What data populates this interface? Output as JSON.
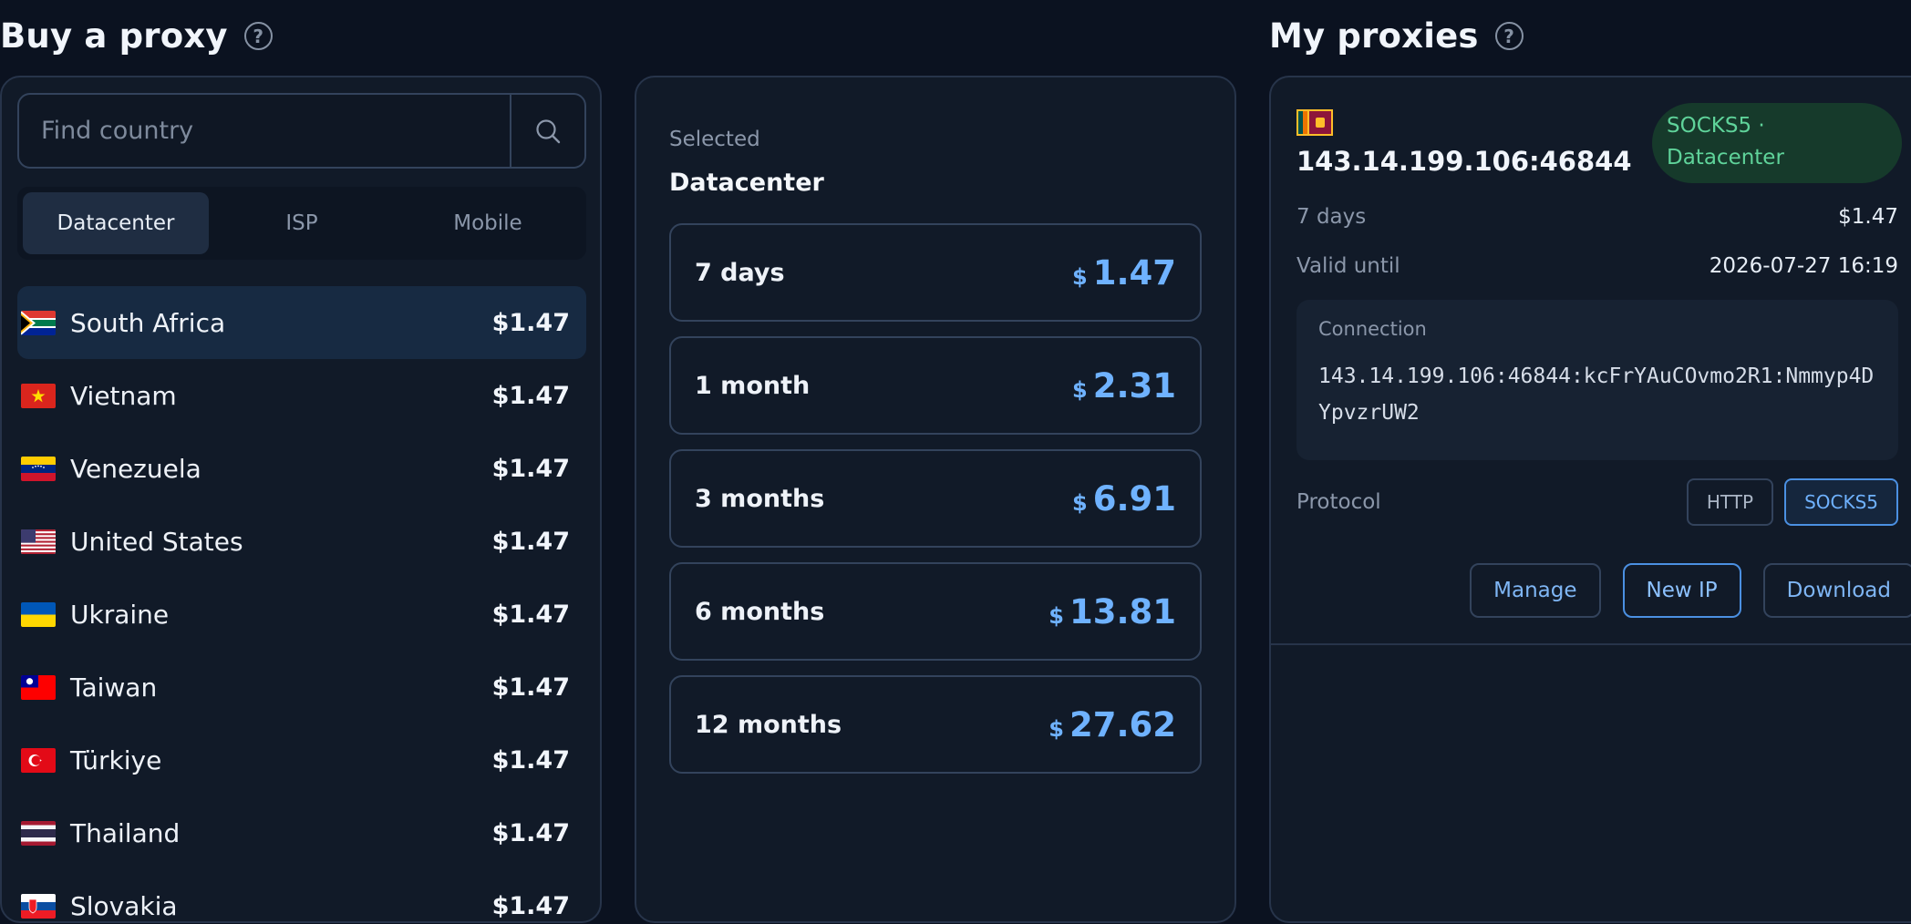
{
  "buy": {
    "title": "Buy a proxy",
    "help": "?",
    "search": {
      "placeholder": "Find country"
    },
    "tabs": [
      {
        "label": "Datacenter",
        "active": true
      },
      {
        "label": "ISP",
        "active": false
      },
      {
        "label": "Mobile",
        "active": false
      }
    ],
    "countries": [
      {
        "name": "South Africa",
        "price": "$1.47",
        "flag": "za-flag-icon",
        "selected": true
      },
      {
        "name": "Vietnam",
        "price": "$1.47",
        "flag": "vn-flag-icon"
      },
      {
        "name": "Venezuela",
        "price": "$1.47",
        "flag": "ve-flag-icon"
      },
      {
        "name": "United States",
        "price": "$1.47",
        "flag": "us-flag-icon"
      },
      {
        "name": "Ukraine",
        "price": "$1.47",
        "flag": "ua-flag-icon"
      },
      {
        "name": "Taiwan",
        "price": "$1.47",
        "flag": "tw-flag-icon"
      },
      {
        "name": "Türkiye",
        "price": "$1.47",
        "flag": "tr-flag-icon"
      },
      {
        "name": "Thailand",
        "price": "$1.47",
        "flag": "th-flag-icon"
      },
      {
        "name": "Slovakia",
        "price": "$1.47",
        "flag": "sk-flag-icon"
      }
    ]
  },
  "plans": {
    "selected_label": "Selected",
    "selected_value": "Datacenter",
    "currency": "$",
    "items": [
      {
        "name": "7 days",
        "price": "1.47"
      },
      {
        "name": "1 month",
        "price": "2.31"
      },
      {
        "name": "3 months",
        "price": "6.91"
      },
      {
        "name": "6 months",
        "price": "13.81"
      },
      {
        "name": "12 months",
        "price": "27.62"
      }
    ]
  },
  "mine": {
    "title": "My proxies",
    "help": "?",
    "proxy": {
      "flag": "lk-flag-icon",
      "address": "143.14.199.106:46844",
      "badge_line1": "SOCKS5 ·",
      "badge_line2": "Datacenter",
      "duration": "7 days",
      "price": "$1.47",
      "valid_until_label": "Valid until",
      "valid_until": "2026-07-27 16:19",
      "connection_label": "Connection",
      "connection": "143.14.199.106:46844:kcFrYAuCOvmo2R1:Nmmyp4DYpvzrUW2",
      "protocol_label": "Protocol",
      "protocols": [
        {
          "label": "HTTP",
          "active": false
        },
        {
          "label": "SOCKS5",
          "active": true
        }
      ],
      "actions": {
        "manage": "Manage",
        "new_ip": "New IP",
        "download": "Download"
      }
    }
  },
  "colors": {
    "accent": "#6fb2ff",
    "success": "#5fd39a",
    "background": "#0b1220",
    "panel": "#111a28"
  }
}
